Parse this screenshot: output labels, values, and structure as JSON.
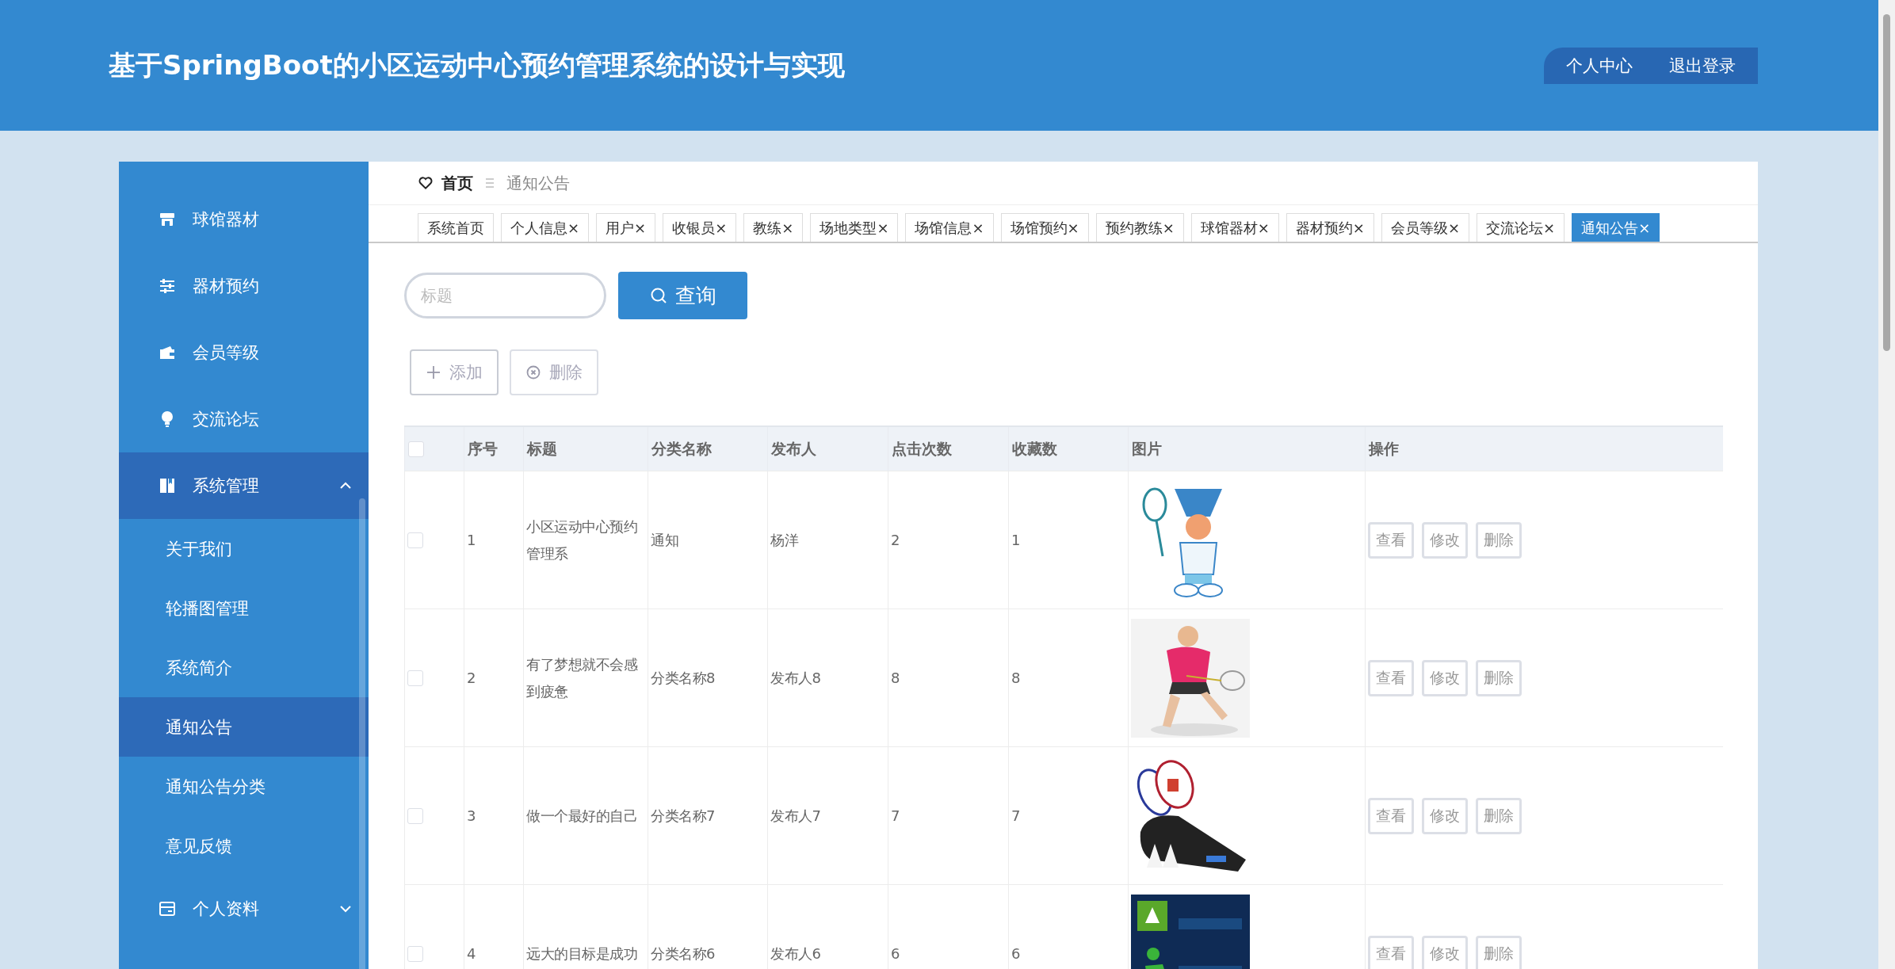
{
  "header": {
    "title": "基于SpringBoot的小区运动中心预约管理系统的设计与实现",
    "links": [
      "个人中心",
      "退出登录"
    ]
  },
  "sidebar": {
    "items": [
      {
        "label": "球馆器材",
        "selected": false
      },
      {
        "label": "器材预约",
        "selected": false
      },
      {
        "label": "会员等级",
        "selected": false
      },
      {
        "label": "交流论坛",
        "selected": false
      },
      {
        "label": "系统管理",
        "selected": false,
        "expanded": true,
        "children": [
          {
            "label": "关于我们",
            "selected": false
          },
          {
            "label": "轮播图管理",
            "selected": false
          },
          {
            "label": "系统简介",
            "selected": false
          },
          {
            "label": "通知公告",
            "selected": true
          },
          {
            "label": "通知公告分类",
            "selected": false
          },
          {
            "label": "意见反馈",
            "selected": false
          }
        ]
      },
      {
        "label": "个人资料",
        "selected": false,
        "expanded": false
      }
    ]
  },
  "breadcrumb": {
    "home": "首页",
    "current": "通知公告"
  },
  "tabs": [
    {
      "label": "系统首页",
      "selected": false
    },
    {
      "label": "个人信息",
      "close": "×",
      "selected": false
    },
    {
      "label": "用户",
      "close": "×",
      "selected": false
    },
    {
      "label": "收银员",
      "close": "×",
      "selected": false
    },
    {
      "label": "教练",
      "close": "×",
      "selected": false
    },
    {
      "label": "场地类型",
      "close": "×",
      "selected": false
    },
    {
      "label": "场馆信息",
      "close": "×",
      "selected": false
    },
    {
      "label": "场馆预约",
      "close": "×",
      "selected": false
    },
    {
      "label": "预约教练",
      "close": "×",
      "selected": false
    },
    {
      "label": "球馆器材",
      "close": "×",
      "selected": false
    },
    {
      "label": "器材预约",
      "close": "×",
      "selected": false
    },
    {
      "label": "会员等级",
      "close": "×",
      "selected": false
    },
    {
      "label": "交流论坛",
      "close": "×",
      "selected": false
    },
    {
      "label": "通知公告",
      "close": "×",
      "selected": true
    }
  ],
  "search": {
    "placeholder": "标题",
    "button": "查询"
  },
  "toolbar": [
    "添加",
    "删除"
  ],
  "table": {
    "header_checked": false,
    "columns": [
      "序号",
      "标题",
      "分类名称",
      "发布人",
      "点击次数",
      "收藏数",
      "图片",
      "操作"
    ],
    "rows": [
      {
        "checked": false,
        "cells": [
          "1",
          "小区运动中心预约管理系",
          "通知",
          "杨洋",
          "2",
          "1"
        ],
        "actions": [
          "查看",
          "修改",
          "删除"
        ]
      },
      {
        "checked": false,
        "cells": [
          "2",
          "有了梦想就不会感到疲惫",
          "分类名称8",
          "发布人8",
          "8",
          "8"
        ],
        "actions": [
          "查看",
          "修改",
          "删除"
        ]
      },
      {
        "checked": false,
        "cells": [
          "3",
          "做一个最好的自己",
          "分类名称7",
          "发布人7",
          "7",
          "7"
        ],
        "actions": [
          "查看",
          "修改",
          "删除"
        ]
      },
      {
        "checked": false,
        "cells": [
          "4",
          "远大的目标是成功",
          "分类名称6",
          "发布人6",
          "6",
          "6"
        ],
        "actions": [
          "查看",
          "修改",
          "删除"
        ]
      }
    ]
  }
}
